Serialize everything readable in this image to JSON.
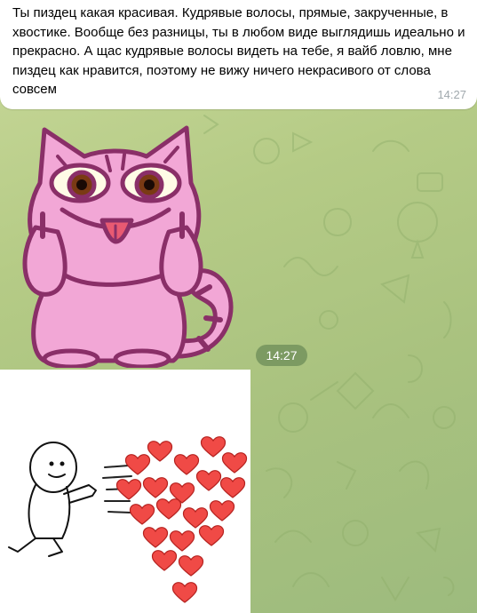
{
  "message": {
    "text": "Ты пиздец какая красивая. Кудрявые волосы, прямые, закрученные, в хвостике. Вообще без разницы, ты в любом виде выглядишь идеально и прекрасно. А щас кудрявые волосы видеть на тебе, я вайб ловлю, мне пиздец как нравится, поэтому не вижу ничего некрасивого от слова совсем",
    "time": "14:27"
  },
  "sticker": {
    "icon": "pink-cat-sticker-icon"
  },
  "sticker_time": "14:27",
  "photo": {
    "icon": "hearts-meme-image"
  },
  "colors": {
    "bubble": "#ffffff",
    "time_text": "#a0a8ad",
    "cat_pink": "#f2a7d6",
    "cat_outline": "#8a2f68",
    "heart_red": "#f04a46",
    "wallpaper": "#b5cb86"
  }
}
